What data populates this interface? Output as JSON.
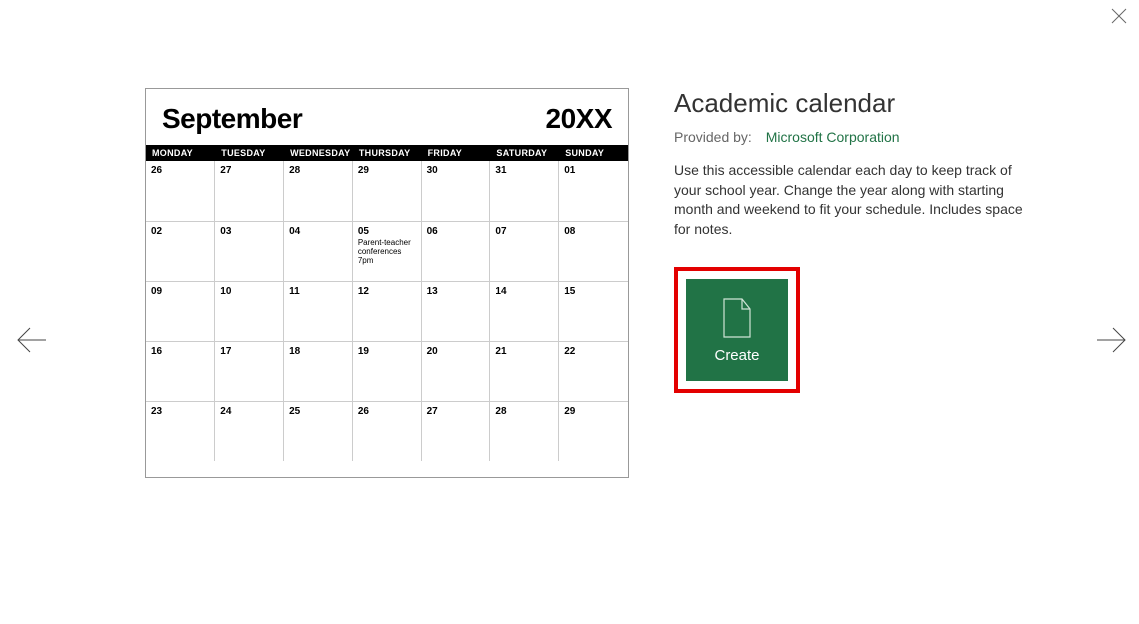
{
  "close": "Close",
  "nav": {
    "prev": "Previous template",
    "next": "Next template"
  },
  "preview": {
    "month": "September",
    "year": "20XX",
    "day_headers": [
      "MONDAY",
      "TUESDAY",
      "WEDNESDAY",
      "THURSDAY",
      "FRIDAY",
      "SATURDAY",
      "SUNDAY"
    ],
    "weeks": [
      [
        {
          "d": "26"
        },
        {
          "d": "27"
        },
        {
          "d": "28"
        },
        {
          "d": "29"
        },
        {
          "d": "30"
        },
        {
          "d": "31"
        },
        {
          "d": "01"
        }
      ],
      [
        {
          "d": "02"
        },
        {
          "d": "03"
        },
        {
          "d": "04"
        },
        {
          "d": "05",
          "note": "Parent-teacher conferences 7pm"
        },
        {
          "d": "06"
        },
        {
          "d": "07"
        },
        {
          "d": "08"
        }
      ],
      [
        {
          "d": "09"
        },
        {
          "d": "10"
        },
        {
          "d": "11"
        },
        {
          "d": "12"
        },
        {
          "d": "13"
        },
        {
          "d": "14"
        },
        {
          "d": "15"
        }
      ],
      [
        {
          "d": "16"
        },
        {
          "d": "17"
        },
        {
          "d": "18"
        },
        {
          "d": "19"
        },
        {
          "d": "20"
        },
        {
          "d": "21"
        },
        {
          "d": "22"
        }
      ],
      [
        {
          "d": "23"
        },
        {
          "d": "24"
        },
        {
          "d": "25"
        },
        {
          "d": "26"
        },
        {
          "d": "27"
        },
        {
          "d": "28"
        },
        {
          "d": "29"
        }
      ]
    ]
  },
  "details": {
    "title": "Academic calendar",
    "provided_label": "Provided by:",
    "provider": "Microsoft Corporation",
    "description": "Use this accessible calendar each day to keep track of your school year. Change the year along with starting month and weekend to fit your schedule. Includes space for notes.",
    "create_label": "Create"
  }
}
